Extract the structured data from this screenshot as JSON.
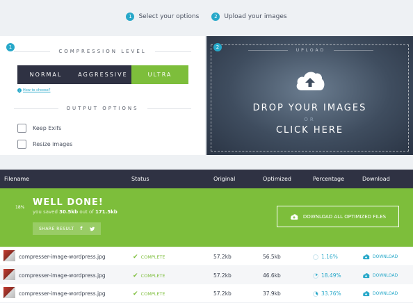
{
  "steps": [
    {
      "num": "1",
      "label": "Select your options"
    },
    {
      "num": "2",
      "label": "Upload your images"
    }
  ],
  "options": {
    "num": "1",
    "compression_title": "COMPRESSION LEVEL",
    "levels": [
      "NORMAL",
      "AGGRESSIVE",
      "ULTRA"
    ],
    "selected_level": "ULTRA",
    "how_to": "How to choose?",
    "output_title": "OUTPUT OPTIONS",
    "keep_exifs": "Keep Exifs",
    "resize": "Resize images"
  },
  "upload": {
    "num": "2",
    "title": "UPLOAD",
    "drop": "DROP YOUR IMAGES",
    "or": "OR",
    "click": "CLICK HERE"
  },
  "table": {
    "headers": [
      "Filename",
      "Status",
      "Original",
      "Optimized",
      "Percentage",
      "Download"
    ]
  },
  "summary": {
    "percent": "18%",
    "title": "WELL DONE!",
    "saved_prefix": "you saved",
    "saved_amount": "30.5kb",
    "saved_mid": "out of",
    "saved_total": "171.5kb",
    "share_label": "SHARE RESULT",
    "download_all": "DOWNLOAD ALL OPTIMIZED FILES"
  },
  "rows": [
    {
      "filename": "compresser-image-wordpress.jpg",
      "status": "COMPLETE",
      "original": "57.2kb",
      "optimized": "56.5kb",
      "percentage": "1.16%",
      "percent_value": 1.16,
      "download": "DOWNLOAD"
    },
    {
      "filename": "compresser-image-wordpress.jpg",
      "status": "COMPLETE",
      "original": "57.2kb",
      "optimized": "46.6kb",
      "percentage": "18.49%",
      "percent_value": 18.49,
      "download": "DOWNLOAD"
    },
    {
      "filename": "compresser-image-wordpress.jpg",
      "status": "COMPLETE",
      "original": "57.2kb",
      "optimized": "37.9kb",
      "percentage": "33.76%",
      "percent_value": 33.76,
      "download": "DOWNLOAD"
    }
  ],
  "colors": {
    "accent": "#27a8c9",
    "success": "#7dbe3b",
    "dark": "#2f3243"
  }
}
